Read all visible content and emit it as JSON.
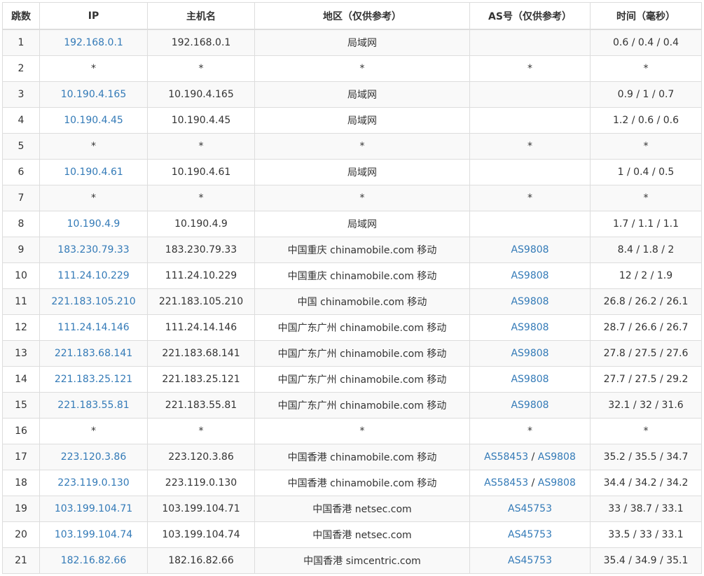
{
  "colors": {
    "link": "#337ab7",
    "text": "#333333",
    "border": "#dddddd",
    "stripe": "#f9f9f9"
  },
  "headers": [
    "跳数",
    "IP",
    "主机名",
    "地区（仅供参考）",
    "AS号（仅供参考）",
    "时间（毫秒）"
  ],
  "rows": [
    {
      "hop": "1",
      "ip": "192.168.0.1",
      "host": "192.168.0.1",
      "region": "局域网",
      "as": [],
      "time": "0.6 / 0.4 / 0.4"
    },
    {
      "hop": "2",
      "ip": "*",
      "host": "*",
      "region": "*",
      "as": [
        "*"
      ],
      "time": "*"
    },
    {
      "hop": "3",
      "ip": "10.190.4.165",
      "host": "10.190.4.165",
      "region": "局域网",
      "as": [],
      "time": "0.9 / 1 / 0.7"
    },
    {
      "hop": "4",
      "ip": "10.190.4.45",
      "host": "10.190.4.45",
      "region": "局域网",
      "as": [],
      "time": "1.2 / 0.6 / 0.6"
    },
    {
      "hop": "5",
      "ip": "*",
      "host": "*",
      "region": "*",
      "as": [
        "*"
      ],
      "time": "*"
    },
    {
      "hop": "6",
      "ip": "10.190.4.61",
      "host": "10.190.4.61",
      "region": "局域网",
      "as": [],
      "time": "1 / 0.4 / 0.5"
    },
    {
      "hop": "7",
      "ip": "*",
      "host": "*",
      "region": "*",
      "as": [
        "*"
      ],
      "time": "*"
    },
    {
      "hop": "8",
      "ip": "10.190.4.9",
      "host": "10.190.4.9",
      "region": "局域网",
      "as": [],
      "time": "1.7 / 1.1 / 1.1"
    },
    {
      "hop": "9",
      "ip": "183.230.79.33",
      "host": "183.230.79.33",
      "region": "中国重庆 chinamobile.com 移动",
      "as": [
        "AS9808"
      ],
      "time": "8.4 / 1.8 / 2"
    },
    {
      "hop": "10",
      "ip": "111.24.10.229",
      "host": "111.24.10.229",
      "region": "中国重庆 chinamobile.com 移动",
      "as": [
        "AS9808"
      ],
      "time": "12 / 2 / 1.9"
    },
    {
      "hop": "11",
      "ip": "221.183.105.210",
      "host": "221.183.105.210",
      "region": "中国 chinamobile.com 移动",
      "as": [
        "AS9808"
      ],
      "time": "26.8 / 26.2 / 26.1"
    },
    {
      "hop": "12",
      "ip": "111.24.14.146",
      "host": "111.24.14.146",
      "region": "中国广东广州 chinamobile.com 移动",
      "as": [
        "AS9808"
      ],
      "time": "28.7 / 26.6 / 26.7"
    },
    {
      "hop": "13",
      "ip": "221.183.68.141",
      "host": "221.183.68.141",
      "region": "中国广东广州 chinamobile.com 移动",
      "as": [
        "AS9808"
      ],
      "time": "27.8 / 27.5 / 27.6"
    },
    {
      "hop": "14",
      "ip": "221.183.25.121",
      "host": "221.183.25.121",
      "region": "中国广东广州 chinamobile.com 移动",
      "as": [
        "AS9808"
      ],
      "time": "27.7 / 27.5 / 29.2"
    },
    {
      "hop": "15",
      "ip": "221.183.55.81",
      "host": "221.183.55.81",
      "region": "中国广东广州 chinamobile.com 移动",
      "as": [
        "AS9808"
      ],
      "time": "32.1 / 32 / 31.6"
    },
    {
      "hop": "16",
      "ip": "*",
      "host": "*",
      "region": "*",
      "as": [
        "*"
      ],
      "time": "*"
    },
    {
      "hop": "17",
      "ip": "223.120.3.86",
      "host": "223.120.3.86",
      "region": "中国香港 chinamobile.com 移动",
      "as": [
        "AS58453",
        "AS9808"
      ],
      "time": "35.2 / 35.5 / 34.7"
    },
    {
      "hop": "18",
      "ip": "223.119.0.130",
      "host": "223.119.0.130",
      "region": "中国香港 chinamobile.com 移动",
      "as": [
        "AS58453",
        "AS9808"
      ],
      "time": "34.4 / 34.2 / 34.2"
    },
    {
      "hop": "19",
      "ip": "103.199.104.71",
      "host": "103.199.104.71",
      "region": "中国香港 netsec.com",
      "as": [
        "AS45753"
      ],
      "time": "33 / 38.7 / 33.1"
    },
    {
      "hop": "20",
      "ip": "103.199.104.74",
      "host": "103.199.104.74",
      "region": "中国香港 netsec.com",
      "as": [
        "AS45753"
      ],
      "time": "33.5 / 33 / 33.1"
    },
    {
      "hop": "21",
      "ip": "182.16.82.66",
      "host": "182.16.82.66",
      "region": "中国香港 simcentric.com",
      "as": [
        "AS45753"
      ],
      "time": "35.4 / 34.9 / 35.1"
    }
  ]
}
